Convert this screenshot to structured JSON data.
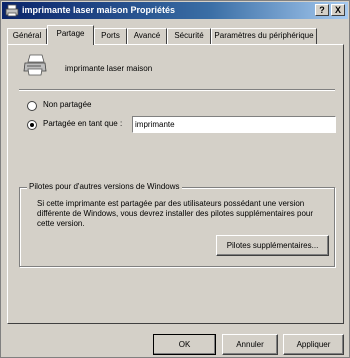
{
  "window": {
    "title": "imprimante laser maison Propriétés",
    "help_label": "?",
    "close_label": "X",
    "title_icon": "printer-icon"
  },
  "tabs": [
    {
      "label": "Général",
      "active": false
    },
    {
      "label": "Partage",
      "active": true
    },
    {
      "label": "Ports",
      "active": false
    },
    {
      "label": "Avancé",
      "active": false
    },
    {
      "label": "Sécurité",
      "active": false
    },
    {
      "label": "Paramètres du périphérique",
      "active": false
    }
  ],
  "printer": {
    "icon": "printer-icon",
    "name": "imprimante laser maison"
  },
  "sharing": {
    "not_shared_label": "Non partagée",
    "shared_as_label": "Partagée en tant que :",
    "selected": "shared_as",
    "share_name": "imprimante"
  },
  "drivers": {
    "legend": "Pilotes pour d'autres versions de Windows",
    "description": "Si cette imprimante est partagée par des utilisateurs possédant une version différente de Windows, vous devrez installer des pilotes supplémentaires pour cette version.",
    "button_label": "Pilotes supplémentaires..."
  },
  "footer": {
    "ok_label": "OK",
    "cancel_label": "Annuler",
    "apply_label": "Appliquer"
  }
}
